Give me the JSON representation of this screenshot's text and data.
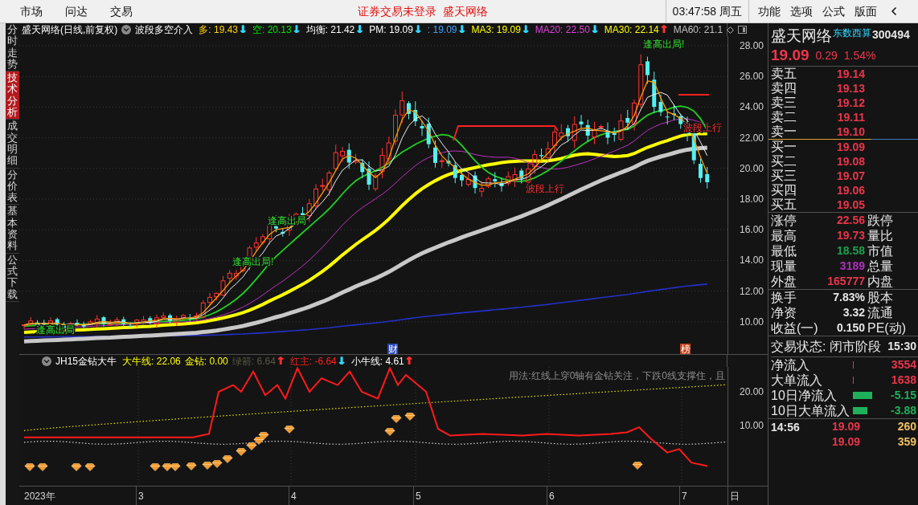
{
  "menu_bar": {
    "left_items": [
      "市场",
      "问达",
      "交易"
    ],
    "notice": "证券交易未登录",
    "broker": "盛天网络",
    "clock": "03:47:58 周五",
    "right_items": [
      "功能",
      "选项",
      "公式",
      "版面"
    ]
  },
  "sidebar": {
    "tabs": [
      {
        "label": "分时走势",
        "selected": false
      },
      {
        "label": "技术分析",
        "selected": true
      },
      {
        "label": "成交明细",
        "selected": false
      },
      {
        "label": "分价表",
        "selected": false
      },
      {
        "label": "基本资料",
        "selected": false
      },
      {
        "label": "公式下载",
        "selected": false
      }
    ]
  },
  "main_chart": {
    "title": "盛天网络(日线,前复权)",
    "indicator": "波段多空介入",
    "readings": [
      {
        "label": "多:",
        "value": "19.43",
        "color": "#ffd400",
        "arrow": {
          "text": "↓",
          "color": "#30d8ff"
        }
      },
      {
        "label": "空:",
        "value": "20.13",
        "color": "#00e600",
        "arrow": {
          "text": "↓",
          "color": "#30d8ff"
        }
      },
      {
        "label": "均衡:",
        "value": "21.42",
        "color": "#ffffff",
        "arrow": {
          "text": "↓",
          "color": "#30d8ff"
        }
      },
      {
        "label": "PM:",
        "value": "19.09",
        "color": "#ffffff",
        "arrow": {
          "text": "↓",
          "color": "#30d8ff"
        }
      },
      {
        "label": ":",
        "value": "19.09",
        "color": "#3fa0ff",
        "arrow": {
          "text": "↓",
          "color": "#30d8ff"
        }
      },
      {
        "label": "MA3:",
        "value": "19.09",
        "color": "#ffff00",
        "arrow": {
          "text": "↓",
          "color": "#30d8ff"
        }
      },
      {
        "label": "MA20:",
        "value": "22.50",
        "color": "#e040e0",
        "arrow": {
          "text": "↓",
          "color": "#30d8ff"
        }
      },
      {
        "label": "MA30:",
        "value": "22.14",
        "color": "#ffff00",
        "arrow": {
          "text": "↑",
          "color": "#ff3030"
        }
      },
      {
        "label": "MA60:",
        "value": "21.1",
        "color": "#c0c0c0"
      }
    ],
    "y_ticks": [
      "28.00",
      "26.00",
      "24.00",
      "22.00",
      "20.00",
      "18.00",
      "16.00",
      "14.00",
      "12.00",
      "10.00"
    ],
    "annotations": [
      {
        "kind": "sell",
        "text": "逢高出局!"
      },
      {
        "kind": "buy",
        "text": "波段上行"
      },
      {
        "kind": "buy",
        "text": "波段上行"
      },
      {
        "kind": "sell",
        "text": "逢高出局"
      },
      {
        "kind": "sell",
        "text": "逢高出局!"
      },
      {
        "kind": "sell",
        "text": "逢高出局"
      }
    ],
    "markers": [
      {
        "kind": "finance",
        "text": "财"
      },
      {
        "kind": "ranking",
        "text": "榜"
      }
    ]
  },
  "lower_chart": {
    "title": "JH15金钻大牛",
    "readings": [
      {
        "label": "大牛线:",
        "value": "22.06",
        "color": "#ffff00"
      },
      {
        "label": "金钻:",
        "value": "0.00",
        "color": "#ffff00"
      },
      {
        "label": "绿箭:",
        "value": "6.64",
        "color": "#5a5a44",
        "arrow": {
          "text": "↑",
          "color": "#ff3030"
        }
      },
      {
        "label": "红主:",
        "value": "-6.64",
        "color": "#ff2020",
        "arrow": {
          "text": "↓",
          "color": "#30d8ff"
        }
      },
      {
        "label": "小牛线:",
        "value": "4.61",
        "color": "#ffffff",
        "arrow": {
          "text": "↑",
          "color": "#ff3030"
        }
      }
    ],
    "note": "用法:红线上穿0轴有金钻关注，下跌0线支撑住，且",
    "y_ticks": [
      "20.00",
      "10.00"
    ]
  },
  "x_axis": {
    "labels": [
      "2023年",
      "3",
      "4",
      "5",
      "6",
      "7",
      "日"
    ]
  },
  "quote": {
    "name": "盛天网络",
    "concept": "东数西算",
    "code": "300494",
    "price": "19.09",
    "change": "0.29",
    "change_percent": "1.54%"
  },
  "order_book": {
    "asks": [
      {
        "label": "卖五",
        "price": "19.14"
      },
      {
        "label": "卖四",
        "price": "19.13"
      },
      {
        "label": "卖三",
        "price": "19.12"
      },
      {
        "label": "卖二",
        "price": "19.11"
      },
      {
        "label": "卖一",
        "price": "19.10"
      }
    ],
    "bids": [
      {
        "label": "买一",
        "price": "19.09"
      },
      {
        "label": "买二",
        "price": "19.08"
      },
      {
        "label": "买三",
        "price": "19.07"
      },
      {
        "label": "买四",
        "price": "19.06"
      },
      {
        "label": "买五",
        "price": "19.05"
      }
    ]
  },
  "stats": [
    {
      "label": "涨停",
      "value": "22.56",
      "color": "#e8364a",
      "label_2": "跌停"
    },
    {
      "label": "最高",
      "value": "19.73",
      "color": "#e8364a",
      "label_2": "量比"
    },
    {
      "label": "最低",
      "value": "18.58",
      "color": "#1fa050",
      "label_2": "市值"
    },
    {
      "label": "现量",
      "value": "3189",
      "color": "#b030c0",
      "label_2": "总量"
    },
    {
      "label": "外盘",
      "value": "165777",
      "color": "#e8364a",
      "label_2": "内盘"
    }
  ],
  "fundamentals": [
    {
      "label": "换手",
      "value": "7.83%",
      "label_2": "股本"
    },
    {
      "label": "净资",
      "value": "3.32",
      "label_2": "流通"
    },
    {
      "label": "收益(一)",
      "value": "0.150",
      "label_2": "PE(动)"
    }
  ],
  "trade_status": {
    "label": "交易状态: 闭市阶段",
    "time": "15:30"
  },
  "fund_flow": [
    {
      "label": "净流入",
      "value": "3554",
      "color": "#e8364a"
    },
    {
      "label": "大单流入",
      "value": "1638",
      "color": "#e8364a"
    },
    {
      "label": "10日净流入",
      "value": "-5.15",
      "color": "#1fb05a"
    },
    {
      "label": "10日大单流入",
      "value": "-3.88",
      "color": "#1fb05a"
    }
  ],
  "ticks": [
    {
      "time": "14:56",
      "price": "19.09",
      "volume": "260"
    },
    {
      "price": "19.09",
      "volume": "359"
    }
  ]
}
